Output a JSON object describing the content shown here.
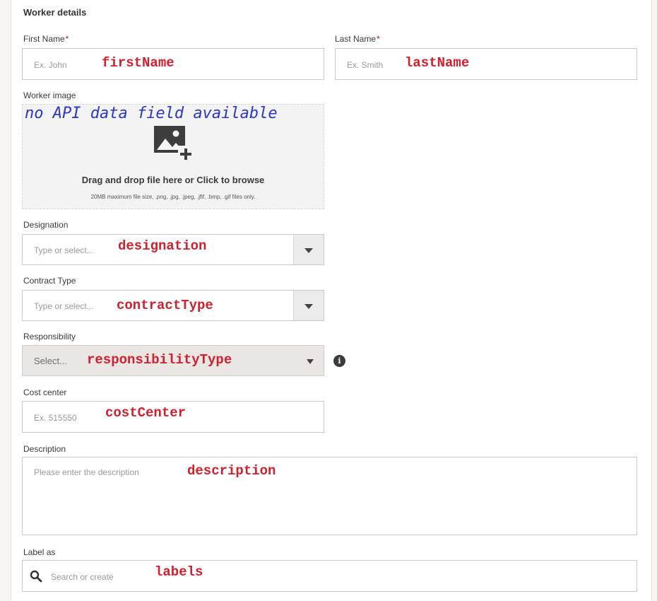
{
  "section_title": "Worker details",
  "first_name": {
    "label": "First Name",
    "required": "*",
    "placeholder": "Ex. John",
    "annotation": "firstName"
  },
  "last_name": {
    "label": "Last Name",
    "required": "*",
    "placeholder": "Ex. Smith",
    "annotation": "lastName"
  },
  "worker_image": {
    "label": "Worker image",
    "annotation": "no API data field available",
    "drop_text": "Drag and drop file here or Click to browse",
    "limits_text": "20MB maximum file size, .png, .jpg, .jpeg, .jfif, .bmp, .gif files only."
  },
  "designation": {
    "label": "Designation",
    "placeholder": "Type or select...",
    "annotation": "designation"
  },
  "contract_type": {
    "label": "Contract Type",
    "placeholder": "Type or select...",
    "annotation": "contractType"
  },
  "responsibility": {
    "label": "Responsibility",
    "placeholder": "Select...",
    "annotation": "responsibilityType",
    "info_glyph": "i"
  },
  "cost_center": {
    "label": "Cost center",
    "placeholder": "Ex. 515550",
    "annotation": "costCenter"
  },
  "description": {
    "label": "Description",
    "placeholder": "Please enter the description",
    "annotation": "description"
  },
  "labels": {
    "label": "Label as",
    "placeholder": "Search or create",
    "annotation": "labels"
  },
  "colors": {
    "required": "#c8102e",
    "annotation_red": "#d0202e",
    "annotation_blue": "#2b36c9"
  },
  "icons": [
    "image-add-icon",
    "chevron-down-icon",
    "info-icon",
    "search-icon"
  ]
}
